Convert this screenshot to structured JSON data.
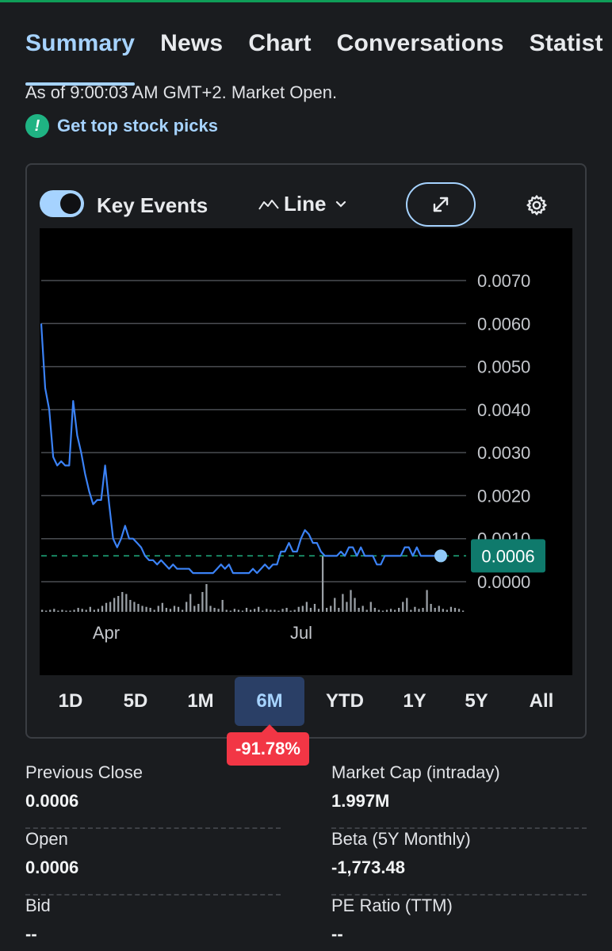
{
  "tabs": [
    {
      "label": "Summary",
      "active": true
    },
    {
      "label": "News",
      "active": false
    },
    {
      "label": "Chart",
      "active": false
    },
    {
      "label": "Conversations",
      "active": false
    },
    {
      "label": "Statist",
      "active": false
    }
  ],
  "status": {
    "as_of": "As of 9:00:03 AM GMT+2. Market Open."
  },
  "promo": {
    "icon": "exclamation-badge-icon",
    "label": "Get top stock picks"
  },
  "chart_controls": {
    "key_events_label": "Key Events",
    "key_events_on": true,
    "chart_type_label": "Line",
    "icons": [
      "line-chart-icon",
      "chevron-down-icon",
      "expand-icon",
      "gear-icon"
    ]
  },
  "chart_data": {
    "type": "line",
    "y_ticks": [
      "0.0070",
      "0.0060",
      "0.0050",
      "0.0040",
      "0.0030",
      "0.0020",
      "0.0010",
      "0.0000"
    ],
    "ylim": [
      0,
      0.007
    ],
    "x_ticks": [
      "Apr",
      "Jul"
    ],
    "current_price_label": "0.0006",
    "current_price": 0.0006,
    "previous_close": 0.0006,
    "grid": true,
    "colors": {
      "line": "#3b82f6",
      "badge": "#0f7a6c",
      "volume": "#9aa0a6",
      "dot": "#90caf9"
    },
    "series": [
      {
        "values": [
          0.006,
          0.0045,
          0.004,
          0.0029,
          0.0027,
          0.0028,
          0.0027,
          0.0027,
          0.0042,
          0.0034,
          0.003,
          0.0025,
          0.0021,
          0.0018,
          0.0019,
          0.0019,
          0.0027,
          0.0018,
          0.001,
          0.0008,
          0.001,
          0.0013,
          0.001,
          0.001,
          0.0009,
          0.0008,
          0.0006,
          0.0005,
          0.0005,
          0.0004,
          0.0005,
          0.0004,
          0.0003,
          0.0004,
          0.0003,
          0.0003,
          0.0003,
          0.0003,
          0.0002,
          0.0002,
          0.0002,
          0.0002,
          0.0002,
          0.0002,
          0.0003,
          0.0004,
          0.0003,
          0.0004,
          0.0002,
          0.0002,
          0.0002,
          0.0002,
          0.0002,
          0.0003,
          0.0002,
          0.0003,
          0.0004,
          0.0003,
          0.0004,
          0.0004,
          0.0007,
          0.0007,
          0.0009,
          0.0007,
          0.0007,
          0.001,
          0.0012,
          0.0011,
          0.0009,
          0.0009,
          0.0007,
          0.0006,
          0.0006,
          0.0006,
          0.0006,
          0.0007,
          0.0006,
          0.0008,
          0.0008,
          0.0006,
          0.0008,
          0.0006,
          0.0006,
          0.0006,
          0.0004,
          0.0004,
          0.0006,
          0.0006,
          0.0006,
          0.0006,
          0.0006,
          0.0008,
          0.0008,
          0.0006,
          0.0008,
          0.0006,
          0.0006,
          0.0006,
          0.0006,
          0.0006,
          0.0006
        ]
      }
    ],
    "volume": [
      2,
      1,
      2,
      3,
      1,
      2,
      1,
      1,
      2,
      4,
      3,
      2,
      5,
      2,
      3,
      6,
      9,
      10,
      14,
      16,
      20,
      18,
      12,
      10,
      8,
      6,
      5,
      4,
      2,
      6,
      9,
      4,
      3,
      6,
      5,
      2,
      10,
      18,
      6,
      8,
      20,
      28,
      6,
      4,
      3,
      12,
      2,
      1,
      3,
      2,
      1,
      4,
      2,
      3,
      5,
      1,
      3,
      2,
      2,
      1,
      3,
      4,
      1,
      2,
      5,
      6,
      10,
      4,
      8,
      3,
      56,
      4,
      6,
      14,
      4,
      18,
      10,
      22,
      14,
      4,
      6,
      2,
      10,
      4,
      2,
      1,
      2,
      3,
      2,
      4,
      10,
      14,
      2,
      5,
      3,
      4,
      22,
      8,
      4,
      6,
      3,
      2,
      5,
      4,
      3,
      1
    ]
  },
  "time_ranges": {
    "items": [
      "1D",
      "5D",
      "1M",
      "6M",
      "YTD",
      "1Y",
      "5Y",
      "All"
    ],
    "active": "6M",
    "change_badge": "-91.78%"
  },
  "stats": {
    "left": [
      {
        "label": "Previous Close",
        "value": "0.0006"
      },
      {
        "label": "Open",
        "value": "0.0006"
      },
      {
        "label": "Bid",
        "value": "--"
      }
    ],
    "right": [
      {
        "label": "Market Cap (intraday)",
        "value": "1.997M"
      },
      {
        "label": "Beta (5Y Monthly)",
        "value": "-1,773.48"
      },
      {
        "label": "PE Ratio (TTM)",
        "value": "--"
      }
    ]
  }
}
